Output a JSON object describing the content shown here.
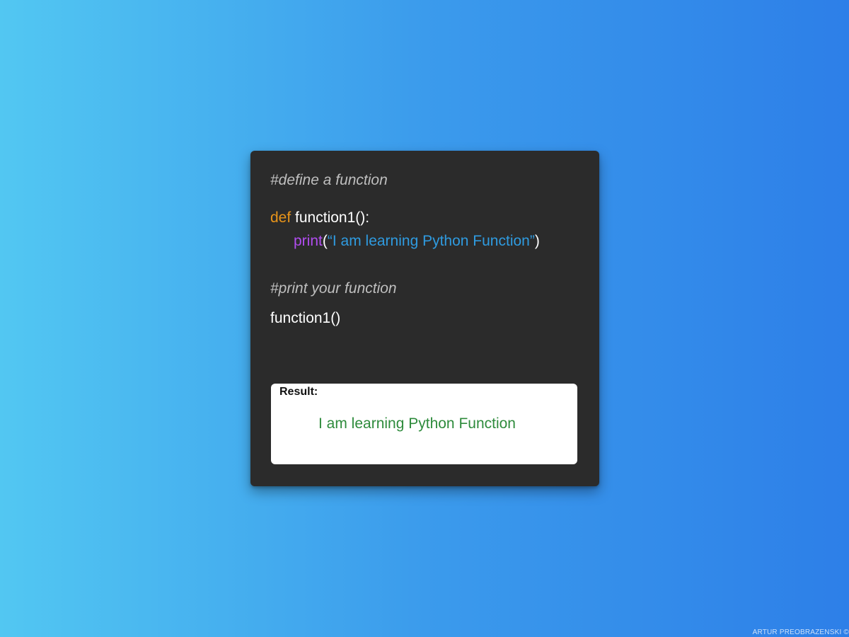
{
  "code": {
    "comment1": "#define a function",
    "def_keyword": "def",
    "def_rest": " function1():",
    "print_keyword": "print",
    "paren_open": "(",
    "string_literal": "“I am learning Python Function”",
    "paren_close": ")",
    "comment2": "#print your function",
    "call": "function1()"
  },
  "result": {
    "label": "Result:",
    "output": "I am learning Python Function"
  },
  "credit": "ARTUR PREOBRAZENSKI ©",
  "colors": {
    "card_bg": "#2b2b2b",
    "keyword_def": "#e8941a",
    "keyword_print": "#b14df0",
    "string": "#2f9be0",
    "comment": "#bfbfbf",
    "result_text": "#2e8b3c"
  }
}
